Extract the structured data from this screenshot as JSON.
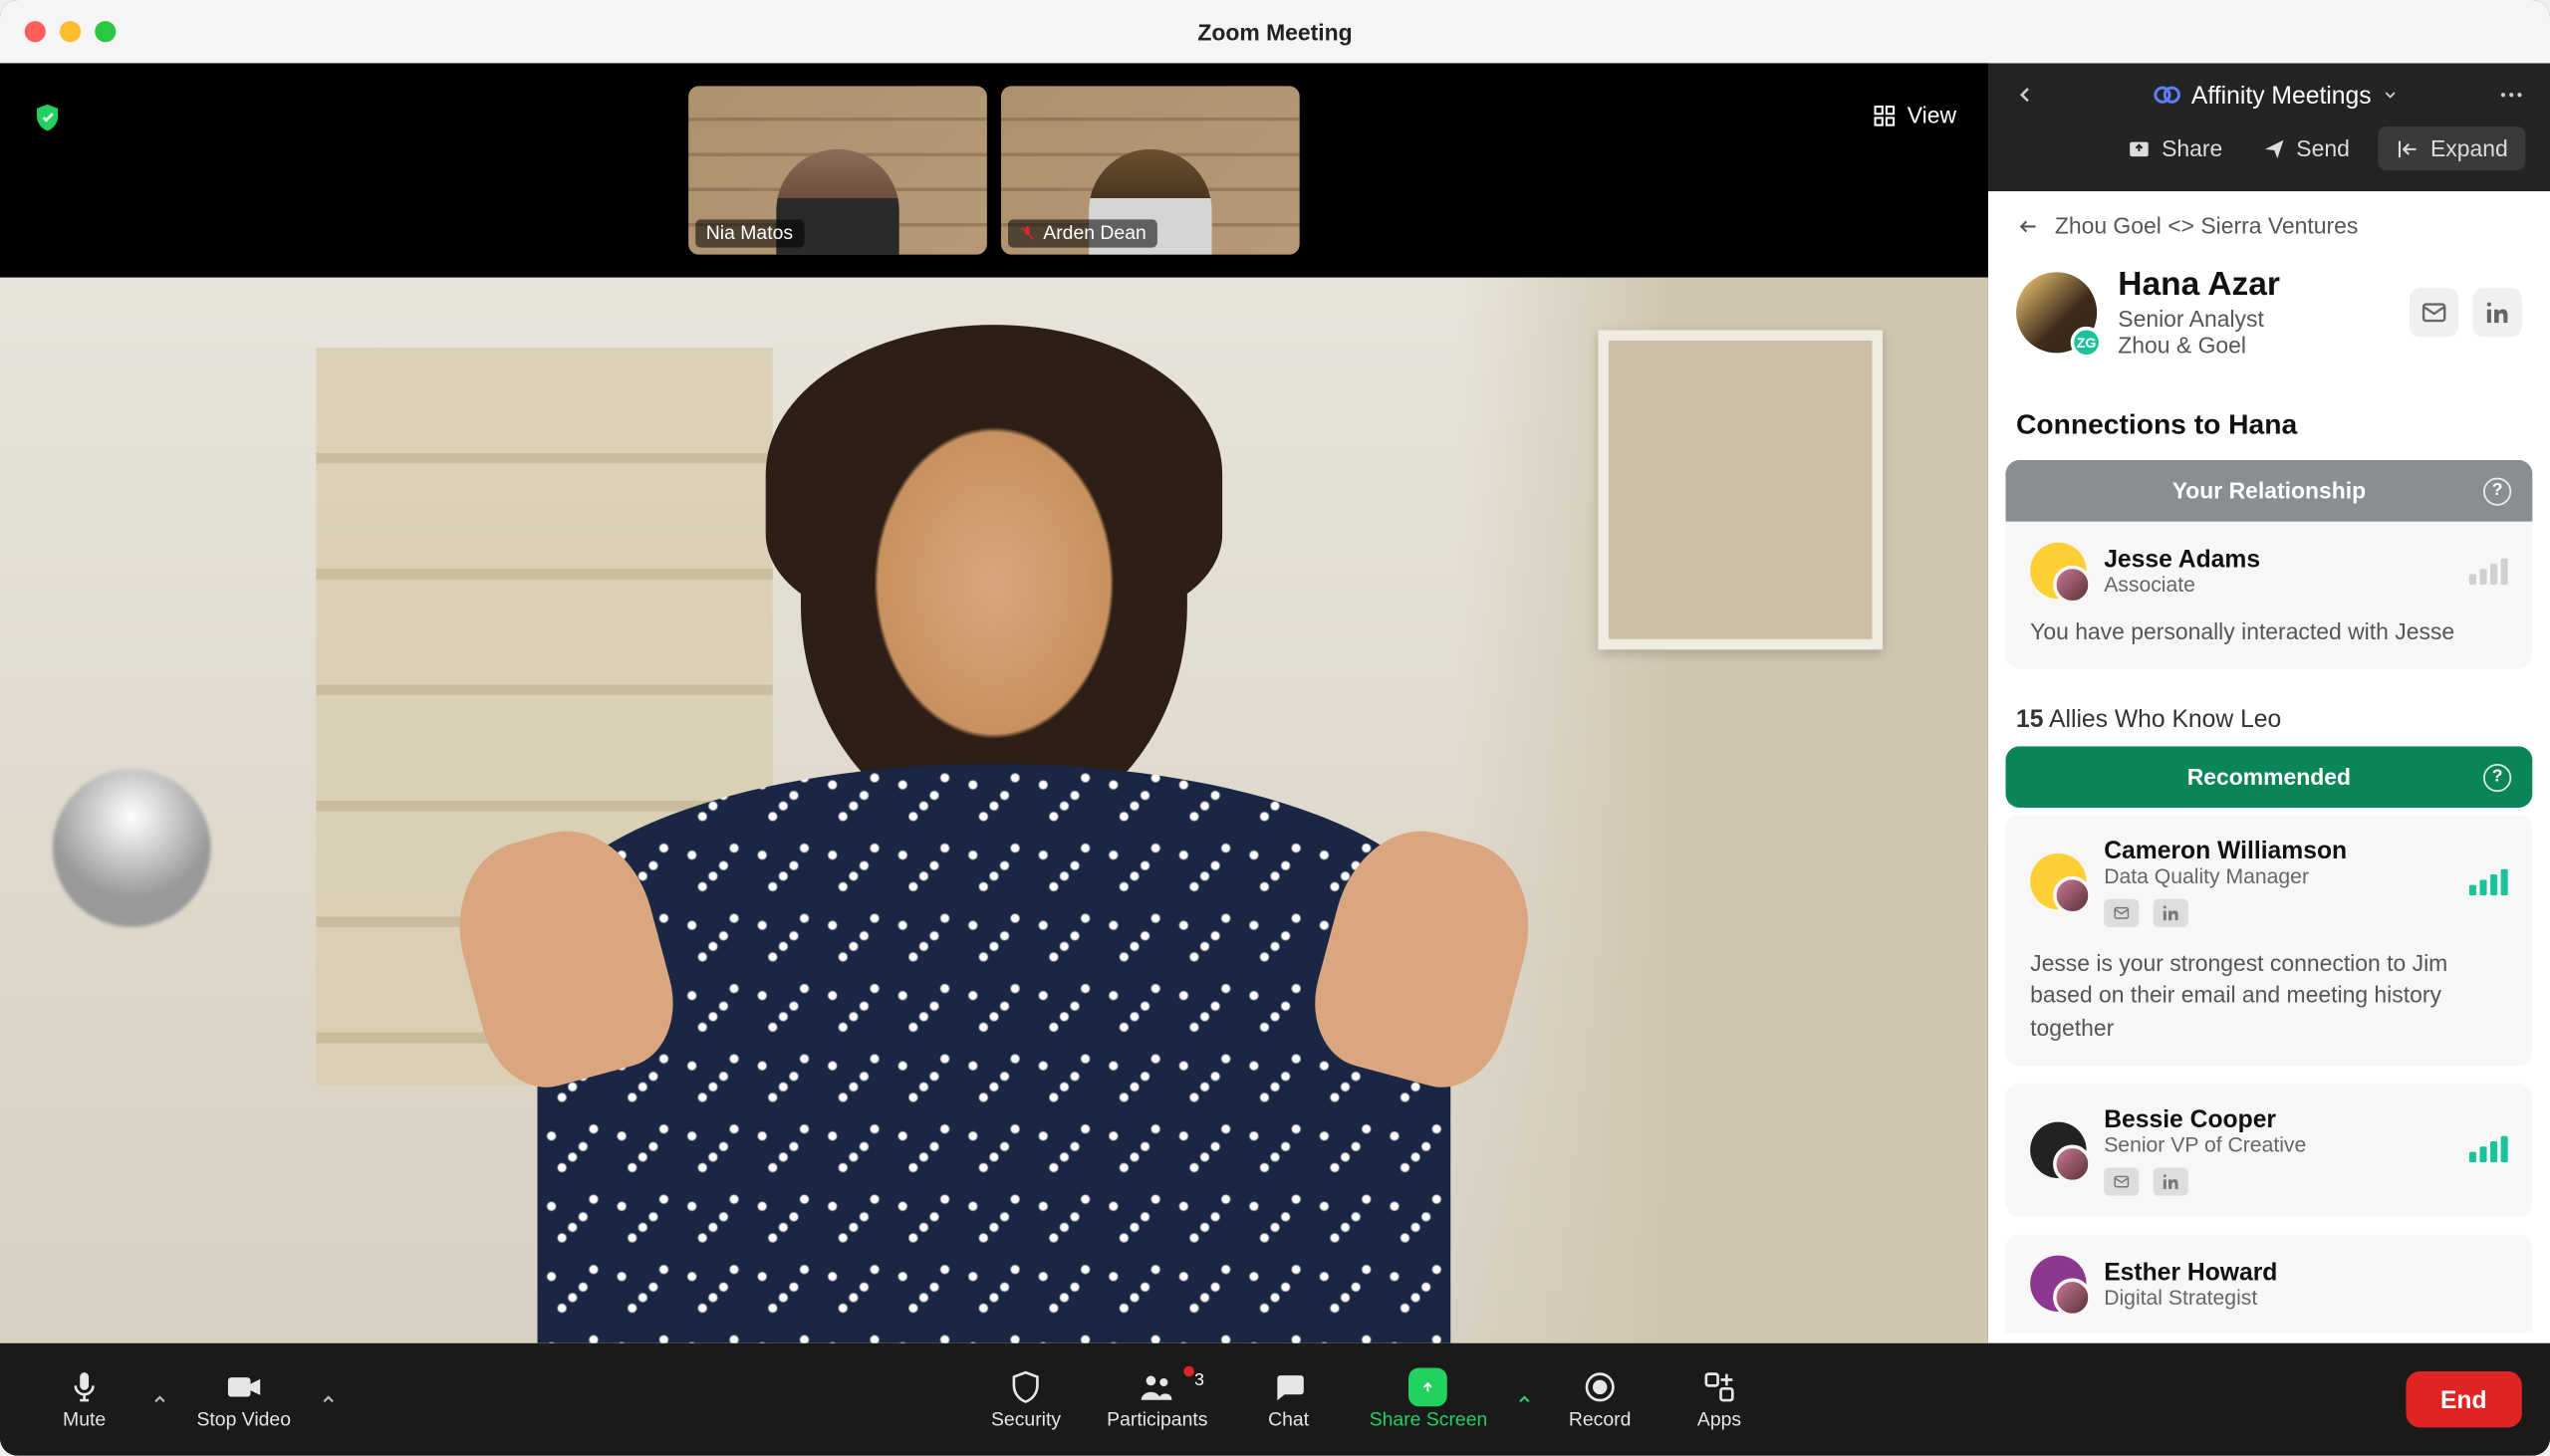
{
  "window": {
    "title": "Zoom Meeting"
  },
  "video": {
    "view_button": "View",
    "thumbnails": [
      {
        "name": "Nia Matos",
        "muted": false
      },
      {
        "name": "Arden Dean",
        "muted": true
      }
    ]
  },
  "toolbar": {
    "mute": "Mute",
    "stop_video": "Stop Video",
    "security": "Security",
    "participants": "Participants",
    "participants_count": "3",
    "chat": "Chat",
    "share_screen": "Share Screen",
    "record": "Record",
    "apps": "Apps",
    "end": "End"
  },
  "panel": {
    "title": "Affinity Meetings",
    "share": "Share",
    "send": "Send",
    "expand": "Expand",
    "breadcrumb": "Zhou Goel <> Sierra Ventures",
    "profile": {
      "name": "Hana Azar",
      "role": "Senior Analyst",
      "company": "Zhou & Goel",
      "avatar_badge": "ZG"
    },
    "connections_title": "Connections to Hana",
    "your_relationship": {
      "header": "Your Relationship",
      "name": "Jesse Adams",
      "role": "Associate",
      "desc": "You have personally interacted with Jesse"
    },
    "allies": {
      "count": "15",
      "label": "Allies Who Know Leo",
      "recommended_header": "Recommended",
      "items": [
        {
          "name": "Cameron Williamson",
          "role": "Data Quality Manager",
          "desc": "Jesse is your strongest connection to Jim based on their email and meeting history together"
        },
        {
          "name": "Bessie Cooper",
          "role": "Senior VP of Creative",
          "desc": ""
        },
        {
          "name": "Esther Howard",
          "role": "Digital Strategist",
          "desc": ""
        }
      ]
    }
  }
}
